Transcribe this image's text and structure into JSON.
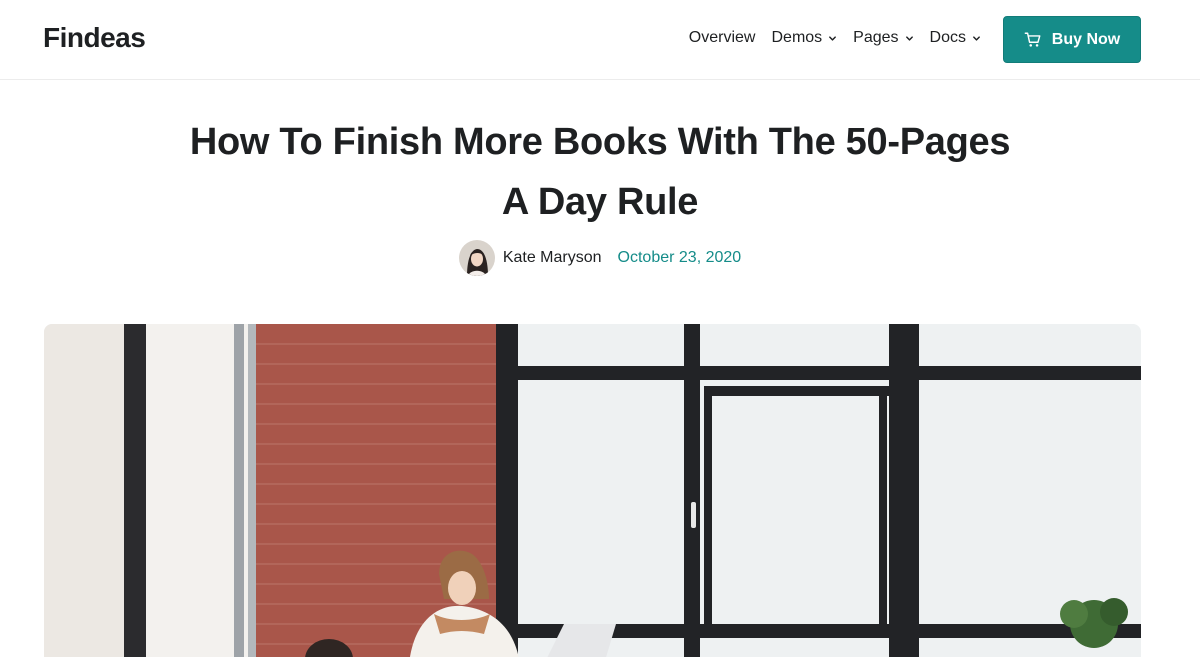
{
  "brand": {
    "name": "Findeas",
    "accent": "#158c89"
  },
  "nav": {
    "items": [
      {
        "label": "Overview",
        "has_dropdown": false
      },
      {
        "label": "Demos",
        "has_dropdown": true
      },
      {
        "label": "Pages",
        "has_dropdown": true
      },
      {
        "label": "Docs",
        "has_dropdown": true
      }
    ],
    "cta": {
      "label": "Buy Now",
      "icon": "cart-icon"
    }
  },
  "article": {
    "title": "How To Finish More Books With The 50-Pages A Day Rule",
    "author": "Kate Maryson",
    "date": "October 23, 2020",
    "hero_image": "office-window-scene"
  }
}
